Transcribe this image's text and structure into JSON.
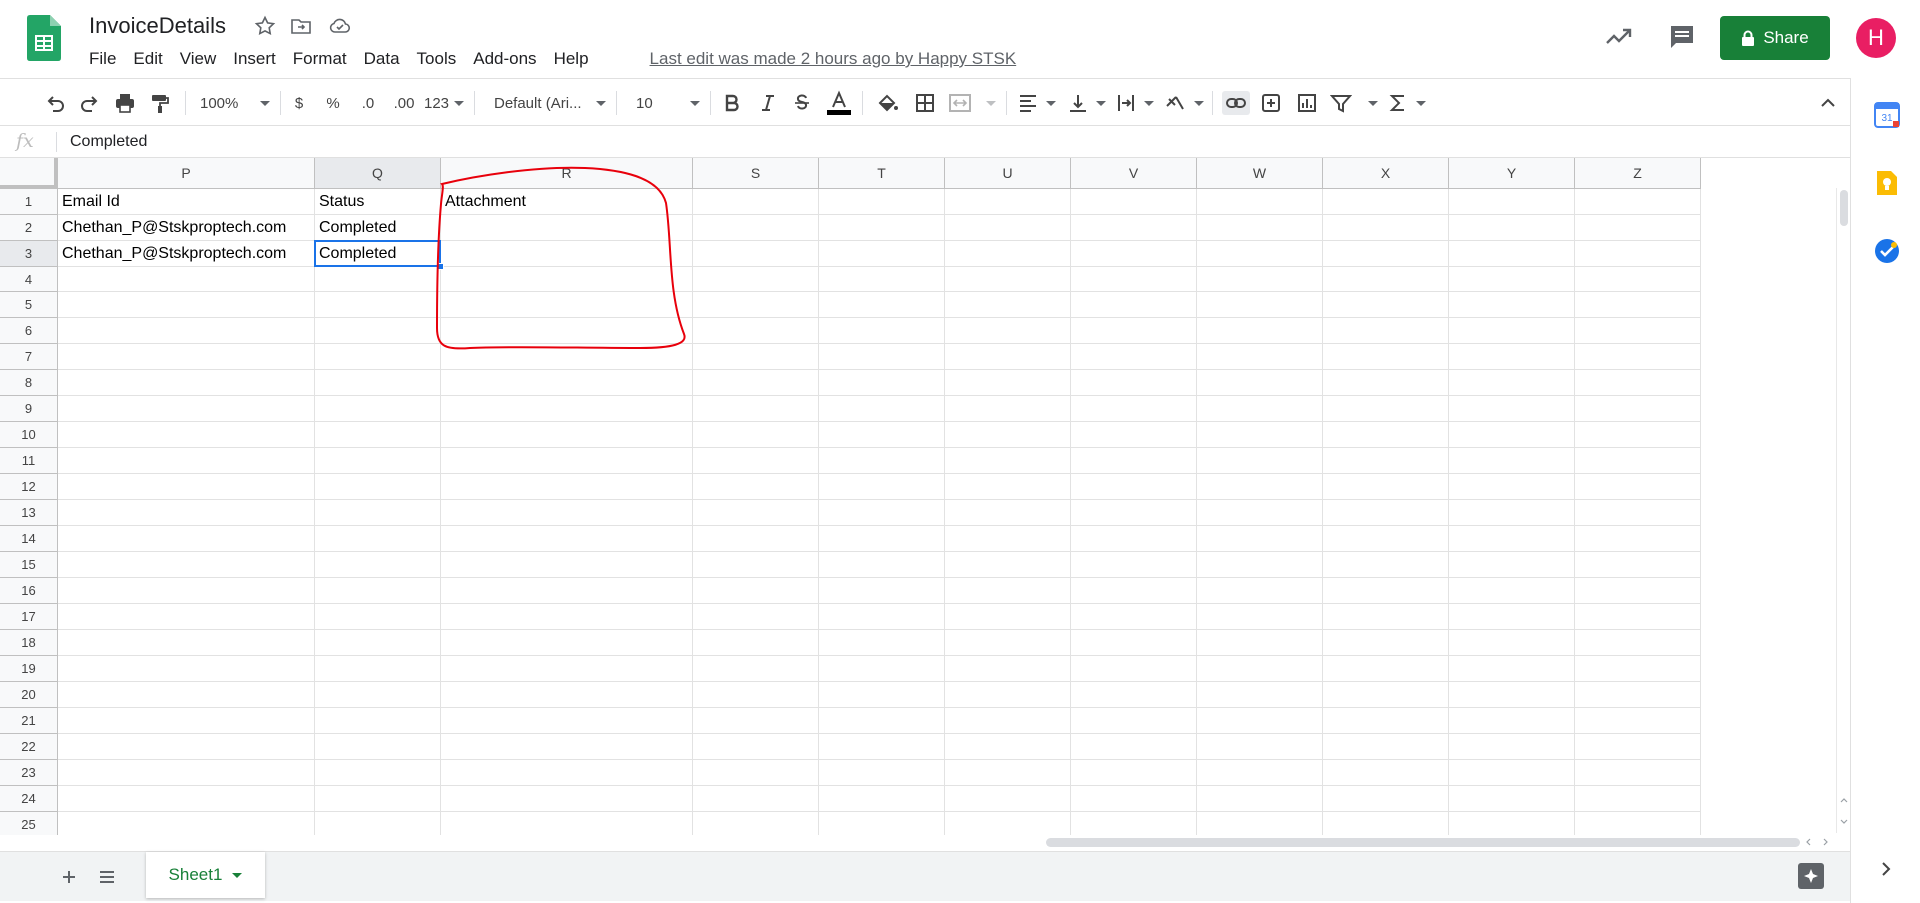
{
  "document": {
    "title": "InvoiceDetails",
    "last_edit": "Last edit was made 2 hours ago by Happy STSK"
  },
  "menu": [
    "File",
    "Edit",
    "View",
    "Insert",
    "Format",
    "Data",
    "Tools",
    "Add-ons",
    "Help"
  ],
  "header": {
    "share_label": "Share",
    "avatar_letter": "H",
    "share_color": "#188038",
    "avatar_color": "#e91e63"
  },
  "toolbar": {
    "zoom": "100%",
    "currency": "$",
    "percent": "%",
    "decrease_decimal": ".0",
    "increase_decimal": ".00",
    "more_formats": "123",
    "font": "Default (Ari...",
    "font_size": "10",
    "icons": [
      "undo-icon",
      "redo-icon",
      "print-icon",
      "paint-format-icon",
      "bold-icon",
      "italic-icon",
      "strikethrough-icon",
      "text-color-icon",
      "fill-color-icon",
      "borders-icon",
      "merge-cells-icon",
      "horizontal-align-icon",
      "vertical-align-icon",
      "text-wrap-icon",
      "text-rotation-icon",
      "insert-link-icon",
      "insert-comment-icon",
      "insert-chart-icon",
      "filter-icon",
      "functions-icon",
      "collapse-icon"
    ]
  },
  "formula_bar": {
    "fx": "fx",
    "value": "Completed"
  },
  "grid": {
    "columns": [
      "P",
      "Q",
      "R",
      "S",
      "T",
      "U",
      "V",
      "W",
      "X",
      "Y",
      "Z"
    ],
    "active_column": "Q",
    "rows": [
      "1",
      "2",
      "3",
      "4",
      "5",
      "6",
      "7",
      "8",
      "9",
      "10",
      "11",
      "12",
      "13",
      "14",
      "15",
      "16",
      "17",
      "18",
      "19",
      "20",
      "21",
      "22",
      "23",
      "24",
      "25"
    ],
    "active_row": "3",
    "cells": [
      [
        "Email Id",
        "Status",
        "Attachment"
      ],
      [
        "Chethan_P@Stskproptech.com",
        "Completed",
        ""
      ],
      [
        "Chethan_P@Stskproptech.com",
        "Completed",
        ""
      ]
    ],
    "selected_cell": "Q3",
    "annotation_color": "#e8000b",
    "selection_color": "#1a73e8"
  },
  "sheets": {
    "tabs": [
      "Sheet1"
    ],
    "active": "Sheet1",
    "add_icon": "plus-icon",
    "list_icon": "all-sheets-icon"
  },
  "side_panel": {
    "icons": [
      "calendar-icon",
      "keep-icon",
      "tasks-icon",
      "chevron-right-icon"
    ],
    "calendar_day": "31"
  }
}
